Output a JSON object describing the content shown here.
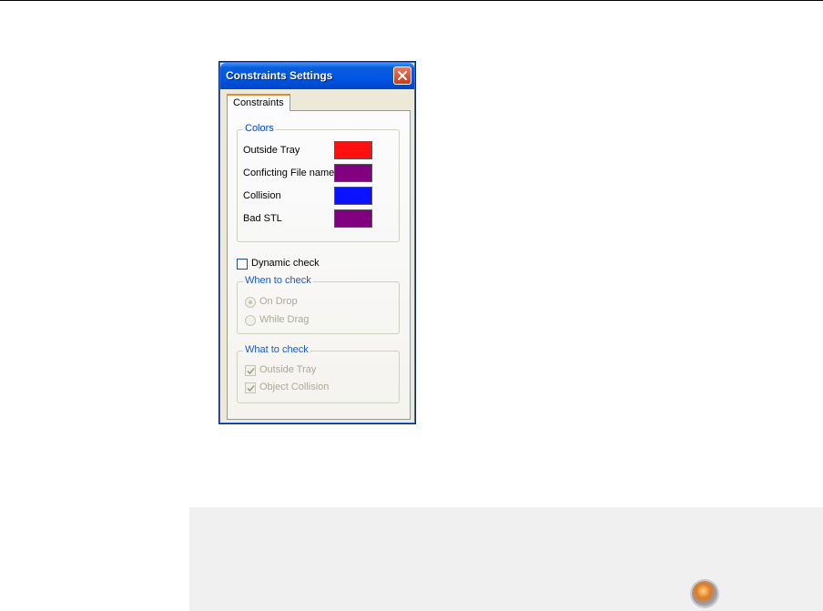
{
  "dialog": {
    "title": "Constraints Settings",
    "tab_label": "Constraints",
    "colors_group": {
      "legend": "Colors",
      "items": [
        {
          "label": "Outside Tray",
          "color": "#ff1010"
        },
        {
          "label": "Conficting File name",
          "color": "#800080"
        },
        {
          "label": "Collision",
          "color": "#0a12ff"
        },
        {
          "label": "Bad STL",
          "color": "#800080"
        }
      ]
    },
    "dynamic_check": {
      "label": "Dynamic check",
      "checked": false
    },
    "when_group": {
      "legend": "When to check",
      "options": [
        {
          "label": "On Drop",
          "selected": true
        },
        {
          "label": "While Drag",
          "selected": false
        }
      ]
    },
    "what_group": {
      "legend": "What to check",
      "options": [
        {
          "label": "Outside Tray",
          "checked": true
        },
        {
          "label": "Object Collision",
          "checked": true
        }
      ]
    }
  },
  "icons": {
    "close": "close-icon",
    "orb": "app-orb-icon"
  }
}
